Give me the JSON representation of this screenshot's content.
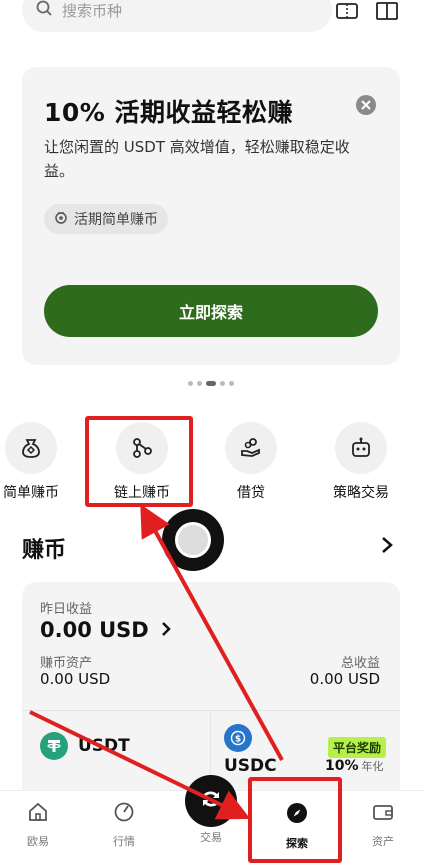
{
  "search": {
    "placeholder": "搜索币种"
  },
  "promo": {
    "title": "10% 活期收益轻松赚",
    "description": "让您闲置的 USDT 高效增值，轻松赚取稳定收益。",
    "tag": "活期简单赚币",
    "cta": "立即探索"
  },
  "features": [
    {
      "label": "简单赚币",
      "icon": "money-bag-icon"
    },
    {
      "label": "链上赚币",
      "icon": "onchain-nodes-icon"
    },
    {
      "label": "借贷",
      "icon": "loan-hand-icon"
    },
    {
      "label": "策略交易",
      "icon": "robot-icon"
    }
  ],
  "earn": {
    "section_title": "赚币",
    "yesterday_label": "昨日收益",
    "yesterday_value": "0.00 USD",
    "asset_label": "赚币资产",
    "asset_value": "0.00 USD",
    "total_label": "总收益",
    "total_value": "0.00 USD",
    "coins": [
      {
        "symbol": "USDT",
        "color": "#26a17b"
      },
      {
        "symbol": "USDC",
        "color": "#2775ca"
      }
    ],
    "badge": "平台奖励",
    "apr_value": "10%",
    "apr_unit": "年化"
  },
  "nav": [
    {
      "label": "欧易",
      "icon": "home-icon"
    },
    {
      "label": "行情",
      "icon": "market-icon"
    },
    {
      "label": "交易",
      "icon": "trade-icon"
    },
    {
      "label": "探索",
      "icon": "compass-icon"
    },
    {
      "label": "资产",
      "icon": "wallet-icon"
    }
  ],
  "colors": {
    "accent_green": "#2e6b1c",
    "annotation_red": "#e02020",
    "badge_green": "#b7f04b"
  }
}
